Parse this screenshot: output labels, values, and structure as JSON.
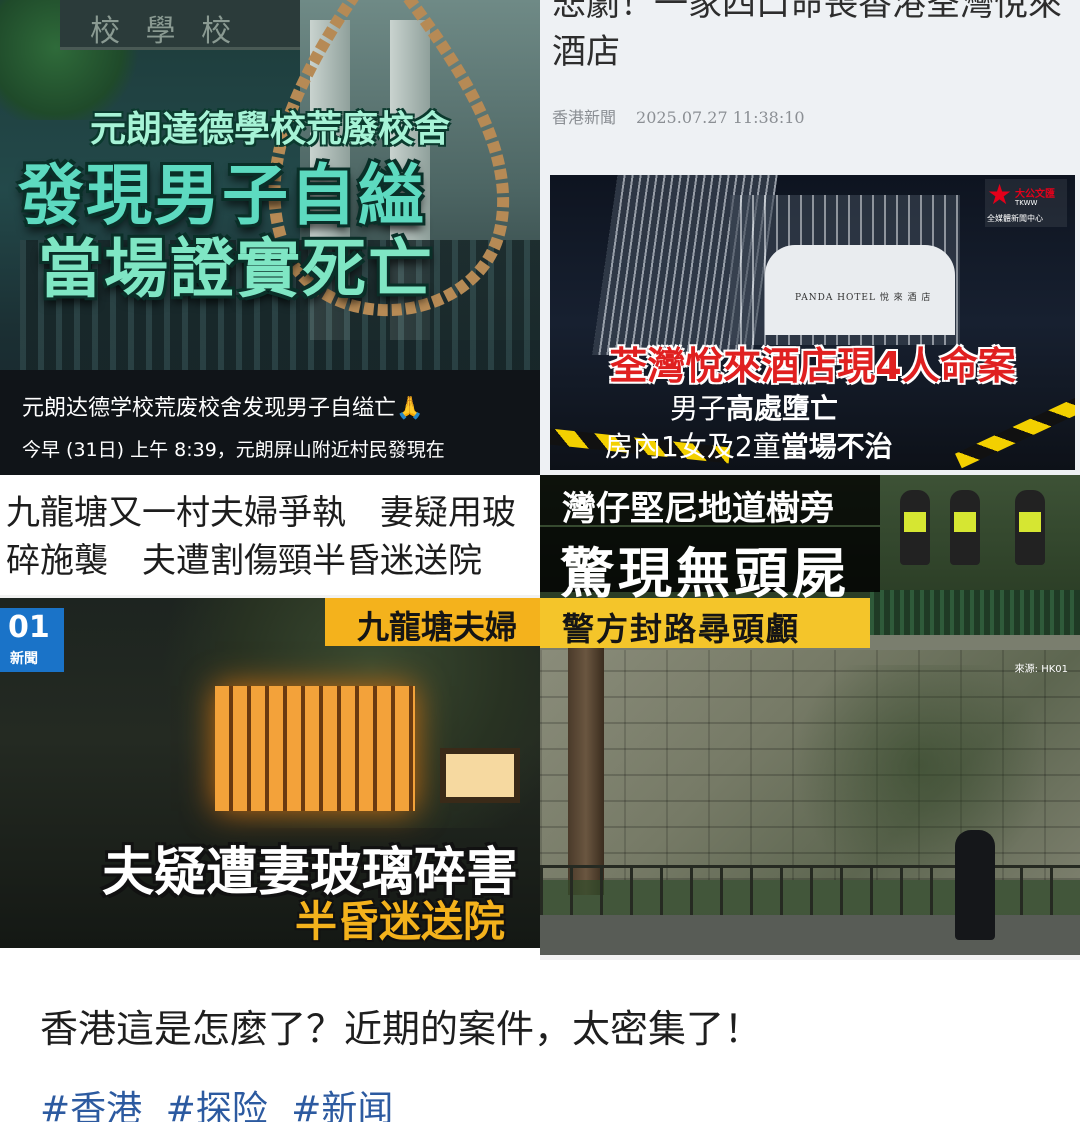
{
  "tile1": {
    "plaque_text": "校 學 校",
    "headline_small": "元朗達德學校荒廢校舍",
    "headline_big_1": "發現男子自縊",
    "headline_big_2": "當場證實死亡",
    "caption_title": "元朗达德学校荒废校舍发现男子自缢亡🙏",
    "caption_body": "今早 (31日) 上午 8:39，元朗屏山附近村民發現在"
  },
  "tile2": {
    "headline": "悲劇！一家四口命喪香港荃灣悅來酒店",
    "source": "香港新聞",
    "datetime": "2025.07.27 11:38:10",
    "logo_text": "大公文匯",
    "logo_sub": "TKWW",
    "logo_caption": "全媒體新聞中心",
    "hotel_sign": "PANDA HOTEL 悅 來 酒 店",
    "red_headline": "荃灣悅來酒店現4人命案",
    "line1_plain": "男子",
    "line1_bold": "高處墮亡",
    "line2_plain": "房內1女及2童",
    "line2_bold": "當場不治"
  },
  "tile3": {
    "line1": "九龍塘又一村夫婦爭執　妻疑用玻",
    "line2": "碎施襲　夫遭割傷頸半昏迷送院"
  },
  "tile4": {
    "brand_top": "01",
    "brand_bottom": "新聞",
    "banner": "九龍塘夫婦",
    "headline": "夫疑遭妻玻璃碎害",
    "subline": "半昏迷送院"
  },
  "tile5": {
    "line1": "灣仔堅尼地道樹旁",
    "line2": "驚現無頭屍",
    "line3": "警方封路尋頭顱",
    "source": "來源: HK01"
  },
  "post": {
    "text": "香港這是怎麼了？近期的案件，太密集了！",
    "tags": [
      "#香港",
      "#探险",
      "#新闻"
    ]
  }
}
